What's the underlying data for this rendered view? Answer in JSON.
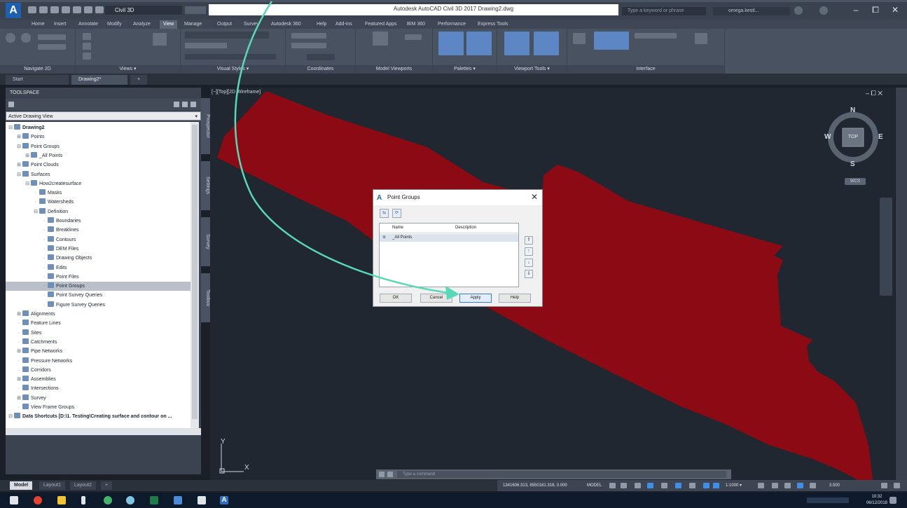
{
  "titlebar": {
    "app_logo": "A",
    "workspace": "Civil 3D",
    "title": "Autodesk AutoCAD Civil 3D 2017   Drawing2.dwg",
    "search_placeholder": "Type a keyword or phrase",
    "signin": "omega.kestl...",
    "minimize": "–",
    "maximize": "⧠",
    "close": "✕"
  },
  "ribbon": {
    "tabs": [
      "Home",
      "Insert",
      "Annotate",
      "Modify",
      "Analyze",
      "View",
      "Manage",
      "Output",
      "Survey",
      "Autodesk 360",
      "Help",
      "Add-ins",
      "Featured Apps",
      "BIM 360",
      "Performance",
      "Express Tools"
    ],
    "active_tab": "View",
    "groups": [
      "Navigate 2D",
      "Views ▾",
      "Visual Styles ▾",
      "Coordinates",
      "Model Viewports",
      "Palettes ▾",
      "Viewport Tools ▾",
      "Interface"
    ]
  },
  "filetabs": {
    "start": "Start",
    "drawing": "Drawing2*",
    "add": "+"
  },
  "toolspace": {
    "title": "TOOLSPACE",
    "view_selector": "Active Drawing View",
    "vertical_tabs": [
      "Prospector",
      "Settings",
      "Survey",
      "Toolbox"
    ],
    "tree": [
      {
        "label": "Drawing2",
        "level": 0,
        "glyph": "⊟"
      },
      {
        "label": "Points",
        "level": 1,
        "glyph": "⊞"
      },
      {
        "label": "Point Groups",
        "level": 1,
        "glyph": "⊟"
      },
      {
        "label": "_All Points",
        "level": 2,
        "glyph": "⊞"
      },
      {
        "label": "Point Clouds",
        "level": 1,
        "glyph": "⊞"
      },
      {
        "label": "Surfaces",
        "level": 1,
        "glyph": "⊟"
      },
      {
        "label": "How2createsurface",
        "level": 2,
        "glyph": "⊟"
      },
      {
        "label": "Masks",
        "level": 3,
        "glyph": ""
      },
      {
        "label": "Watersheds",
        "level": 3,
        "glyph": ""
      },
      {
        "label": "Definition",
        "level": 3,
        "glyph": "⊟"
      },
      {
        "label": "Boundaries",
        "level": 4,
        "glyph": ""
      },
      {
        "label": "Breaklines",
        "level": 4,
        "glyph": ""
      },
      {
        "label": "Contours",
        "level": 4,
        "glyph": ""
      },
      {
        "label": "DEM Files",
        "level": 4,
        "glyph": ""
      },
      {
        "label": "Drawing Objects",
        "level": 4,
        "glyph": ""
      },
      {
        "label": "Edits",
        "level": 4,
        "glyph": ""
      },
      {
        "label": "Point Files",
        "level": 4,
        "glyph": ""
      },
      {
        "label": "Point Groups",
        "level": 4,
        "glyph": "",
        "selected": true
      },
      {
        "label": "Point Survey Queries",
        "level": 4,
        "glyph": ""
      },
      {
        "label": "Figure Survey Queries",
        "level": 4,
        "glyph": ""
      },
      {
        "label": "Alignments",
        "level": 1,
        "glyph": "⊞"
      },
      {
        "label": "Feature Lines",
        "level": 1,
        "glyph": ""
      },
      {
        "label": "Sites",
        "level": 1,
        "glyph": ""
      },
      {
        "label": "Catchments",
        "level": 1,
        "glyph": ""
      },
      {
        "label": "Pipe Networks",
        "level": 1,
        "glyph": "⊞"
      },
      {
        "label": "Pressure Networks",
        "level": 1,
        "glyph": ""
      },
      {
        "label": "Corridors",
        "level": 1,
        "glyph": ""
      },
      {
        "label": "Assemblies",
        "level": 1,
        "glyph": "⊞"
      },
      {
        "label": "Intersections",
        "level": 1,
        "glyph": ""
      },
      {
        "label": "Survey",
        "level": 1,
        "glyph": "⊞"
      },
      {
        "label": "View Frame Groups",
        "level": 1,
        "glyph": ""
      },
      {
        "label": "Data Shortcuts [D:\\1. Testing\\Creating surface and contour on ...",
        "level": 0,
        "glyph": "⊟"
      }
    ]
  },
  "viewport": {
    "label": "[−][Top][2D Wireframe]",
    "controls": "– ⧠ ✕",
    "viewcube": {
      "top": "TOP",
      "north": "N",
      "south": "S",
      "east": "E",
      "west": "W"
    },
    "wcs": "WCS",
    "ucs_x": "X",
    "ucs_y": "Y",
    "surface_color": "#8b0a14"
  },
  "dialog": {
    "title": "Point Groups",
    "icon": "A",
    "close": "✕",
    "columns": [
      "Name",
      "Description"
    ],
    "rows": [
      "_All Points"
    ],
    "buttons": [
      "OK",
      "Cancel",
      "Apply",
      "Help"
    ],
    "focused_button": "Apply"
  },
  "cmdline": {
    "placeholder": "Type a command"
  },
  "layouttabs": [
    "Model",
    "Layout1",
    "Layout2",
    "+"
  ],
  "status": {
    "coords": "1341606.313, 8550181.318, 0.000",
    "space": "MODEL",
    "scale": "1:1000 ▾",
    "annot": "3.500"
  },
  "taskbar": {
    "time": "10:32",
    "date": "06/12/2018"
  },
  "colors": {
    "arrow": "#57d8b6",
    "accent_blue": "#1f5fb0",
    "surface": "#8b0a14"
  }
}
